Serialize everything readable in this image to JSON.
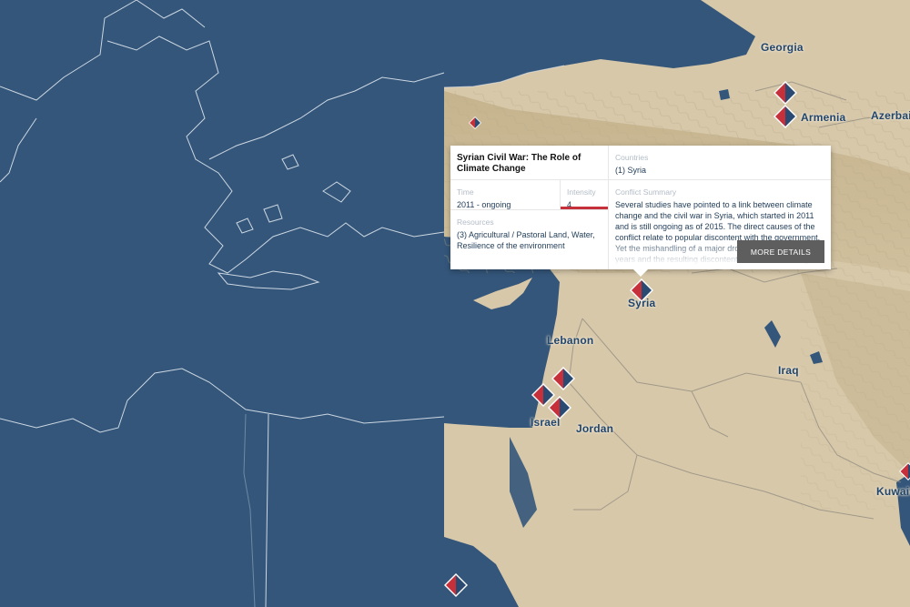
{
  "map": {
    "labels": {
      "georgia": "Georgia",
      "armenia": "Armenia",
      "azerbaijan": "Azerbaij",
      "syria": "Syria",
      "lebanon": "Lebanon",
      "iraq": "Iraq",
      "israel": "Israel",
      "jordan": "Jordan",
      "kuwait": "Kuwait"
    },
    "colors": {
      "sea": "#34567a",
      "land": "#d7c8aa",
      "marker_red": "#c6303b",
      "marker_blue": "#2a4a72",
      "label": "#22456c"
    }
  },
  "popup": {
    "title": "Syrian Civil War: The Role of Climate Change",
    "countries_label": "Countries",
    "countries_value": "(1) Syria",
    "time_label": "Time",
    "time_value": "2011 - ongoing",
    "intensity_label": "Intensity",
    "intensity_value": "4",
    "resources_label": "Resources",
    "resources_value": "(3) Agricultural / Pastoral Land, Water, Resilience of the environment",
    "summary_label": "Conflict Summary",
    "summary_text": "Several studies have pointed to a link between climate change and the civil war in Syria, which started in 2011 and is still ongoing as of 2015. The direct causes of the conflict relate to popular discontent with the government. Yet the mishandling of a major drought in the preceding years and the resulting discontent, and climate change increased",
    "more_details_label": "MORE DETAILS"
  }
}
